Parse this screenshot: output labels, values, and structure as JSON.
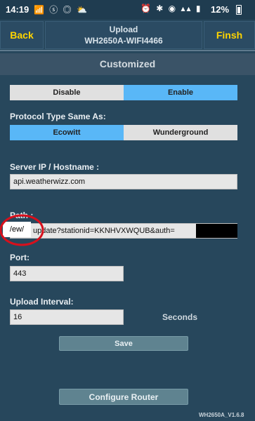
{
  "status_bar": {
    "time": "14:19",
    "left_icons": "📶 ⓢ ◎ ⛅",
    "right_icons": "⏰ ✱ ◉ ▴▴ ▮",
    "battery": "12%"
  },
  "header": {
    "back_label": "Back",
    "title_line1": "Upload",
    "title_line2": "WH2650A-WIFI4466",
    "finish_label": "Finsh"
  },
  "subheader": {
    "title": "Customized"
  },
  "enable_toggle": {
    "options": [
      "Disable",
      "Enable"
    ],
    "selected": "Enable"
  },
  "protocol": {
    "label": "Protocol Type Same As:",
    "options": [
      "Ecowitt",
      "Wunderground"
    ],
    "selected": "Ecowitt"
  },
  "server": {
    "label": "Server IP / Hostname :",
    "value": "api.weatherwizz.com"
  },
  "path": {
    "label": "Path :",
    "value": "update?stationid=KKNHVXWQUB&auth=",
    "annotation": "/ew/"
  },
  "port": {
    "label": "Port:",
    "value": "443"
  },
  "interval": {
    "label": "Upload Interval:",
    "value": "16",
    "unit": "Seconds"
  },
  "save_label": "Save",
  "configure_label": "Configure Router",
  "version": "WH2650A_V1.6.8",
  "colors": {
    "background": "#27475c",
    "accent_yellow": "#ffd400",
    "selected_blue": "#59b7f7",
    "button": "#5f8390",
    "annotation_red": "#d8101c"
  }
}
